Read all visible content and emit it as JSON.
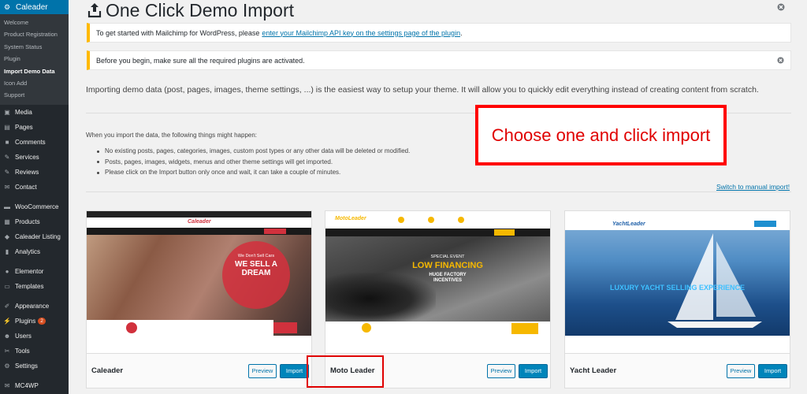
{
  "sidebar": {
    "brand": "Caleader",
    "submenu": [
      "Welcome",
      "Product Registration",
      "System Status",
      "Plugin",
      "Import Demo Data",
      "Icon Add",
      "Support"
    ],
    "items": [
      {
        "label": "Media",
        "icon": "media-icon"
      },
      {
        "label": "Pages",
        "icon": "pages-icon"
      },
      {
        "label": "Comments",
        "icon": "comments-icon"
      },
      {
        "label": "Services",
        "icon": "pin-icon"
      },
      {
        "label": "Reviews",
        "icon": "pin-icon"
      },
      {
        "label": "Contact",
        "icon": "mail-icon"
      },
      {
        "label": "WooCommerce",
        "icon": "woocommerce-icon"
      },
      {
        "label": "Products",
        "icon": "products-icon"
      },
      {
        "label": "Caleader Listing",
        "icon": "car-icon"
      },
      {
        "label": "Analytics",
        "icon": "analytics-icon"
      },
      {
        "label": "Elementor",
        "icon": "elementor-icon"
      },
      {
        "label": "Templates",
        "icon": "templates-icon"
      },
      {
        "label": "Appearance",
        "icon": "brush-icon"
      },
      {
        "label": "Plugins",
        "icon": "plugin-icon",
        "badge": "2"
      },
      {
        "label": "Users",
        "icon": "users-icon"
      },
      {
        "label": "Tools",
        "icon": "tools-icon"
      },
      {
        "label": "Settings",
        "icon": "settings-icon"
      },
      {
        "label": "MC4WP",
        "icon": "mail-icon"
      }
    ]
  },
  "page": {
    "title": "One Click Demo Import",
    "notice1_text": "To get started with Mailchimp for WordPress, please",
    "notice1_link": "enter your Mailchimp API key on the settings page of the plugin",
    "notice1_end": ".",
    "notice2_text": "Before you begin, make sure all the required plugins are activated.",
    "intro": "Importing demo data (post, pages, images, theme settings, ...) is the easiest way to setup your theme. It will allow you to quickly edit everything instead of creating content from scratch.",
    "subhead": "When you import the data, the following things might happen:",
    "bullets": [
      "No existing posts, pages, categories, images, custom post types or any other data will be deleted or modified.",
      "Posts, pages, images, widgets, menus and other theme settings will get imported.",
      "Please click on the Import button only once and wait, it can take a couple of minutes."
    ],
    "manual_link": "Switch to manual import!",
    "callout": "Choose one and click import"
  },
  "cards": [
    {
      "name": "Caleader",
      "preview": "Preview",
      "import": "Import",
      "slogan_small": "We Don't Sell Cars",
      "slogan_big": "WE SELL A DREAM",
      "logo": "Caleader"
    },
    {
      "name": "Moto Leader",
      "preview": "Preview",
      "import": "Import",
      "slogan_small": "SPECIAL EVENT",
      "slogan_big": "LOW FINANCING",
      "slogan_sub": "HUGE FACTORY INCENTIVES",
      "logo": "MotoLeader"
    },
    {
      "name": "Yacht Leader",
      "preview": "Preview",
      "import": "Import",
      "slogan_big": "LUXURY YACHT SELLING EXPERIENCE",
      "logo": "YachtLeader"
    }
  ],
  "colors": {
    "accent": "#0073aa",
    "warning": "#ffb900",
    "callout": "#e00000",
    "sidebar": "#23282d"
  }
}
